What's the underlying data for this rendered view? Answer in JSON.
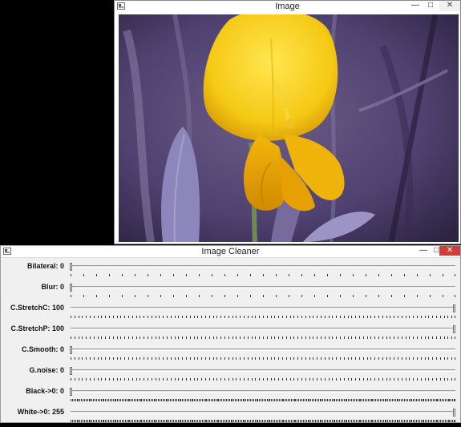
{
  "image_window": {
    "title": "Image",
    "controls": {
      "minimize": "—",
      "maximize": "□",
      "close": "✕"
    }
  },
  "cleaner_window": {
    "title": "Image Cleaner",
    "controls": {
      "minimize": "—",
      "maximize": "□",
      "close": "✕"
    },
    "sliders": [
      {
        "label": "Bilateral: 0",
        "value": 0,
        "max": 30
      },
      {
        "label": "Blur: 0",
        "value": 0,
        "max": 30
      },
      {
        "label": "C.StretchC: 100",
        "value": 100,
        "max": 100
      },
      {
        "label": "C.StretchP: 100",
        "value": 100,
        "max": 100
      },
      {
        "label": "C.Smooth: 0",
        "value": 0,
        "max": 100
      },
      {
        "label": "G.noise: 0",
        "value": 0,
        "max": 100
      },
      {
        "label": "Black->0: 0",
        "value": 0,
        "max": 255
      },
      {
        "label": "White->0: 255",
        "value": 255,
        "max": 255
      }
    ]
  },
  "colors": {
    "petal": "#f5c915",
    "petal_shadow": "#d69a06",
    "background_purple": "#5e4e7e",
    "close_button": "#c7413a"
  }
}
